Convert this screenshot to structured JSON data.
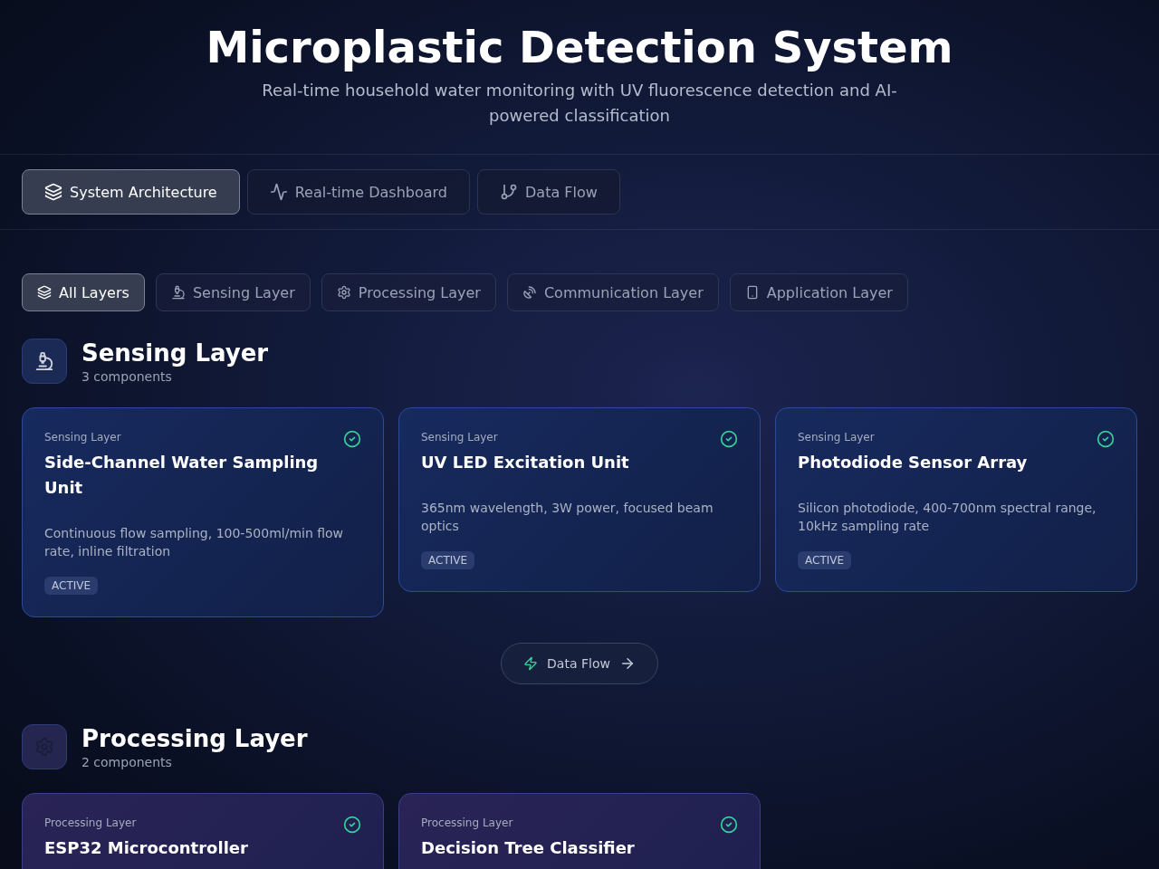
{
  "header": {
    "title": "Microplastic Detection System",
    "subtitle": "Real-time household water monitoring with UV fluorescence detection and AI-powered classification"
  },
  "tabs": [
    {
      "label": "System Architecture",
      "selected": true
    },
    {
      "label": "Real-time Dashboard",
      "selected": false
    },
    {
      "label": "Data Flow",
      "selected": false
    }
  ],
  "filters": [
    {
      "label": "All Layers",
      "selected": true
    },
    {
      "label": "Sensing Layer",
      "selected": false
    },
    {
      "label": "Processing Layer",
      "selected": false
    },
    {
      "label": "Communication Layer",
      "selected": false
    },
    {
      "label": "Application Layer",
      "selected": false
    }
  ],
  "sections": [
    {
      "title": "Sensing Layer",
      "count": "3 components",
      "components": [
        {
          "category": "Sensing Layer",
          "title": "Side-Channel Water Sampling Unit",
          "description": "Continuous flow sampling, 100-500ml/min flow rate, inline filtration",
          "status": "ACTIVE",
          "ok": true
        },
        {
          "category": "Sensing Layer",
          "title": "UV LED Excitation Unit",
          "description": "365nm wavelength, 3W power, focused beam optics",
          "status": "ACTIVE",
          "ok": true
        },
        {
          "category": "Sensing Layer",
          "title": "Photodiode Sensor Array",
          "description": "Silicon photodiode, 400-700nm spectral range, 10kHz sampling rate",
          "status": "ACTIVE",
          "ok": true
        }
      ]
    },
    {
      "title": "Processing Layer",
      "count": "2 components",
      "components": [
        {
          "category": "Processing Layer",
          "title": "ESP32 Microcontroller",
          "ok": true
        },
        {
          "category": "Processing Layer",
          "title": "Decision Tree Classifier",
          "ok": true
        }
      ]
    }
  ],
  "flow_button": {
    "label": "Data Flow"
  }
}
